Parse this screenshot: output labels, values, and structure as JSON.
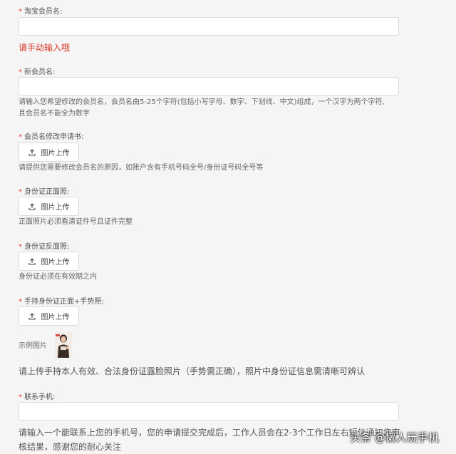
{
  "fields": {
    "taobao_name": {
      "label": "淘宝会员名:",
      "value": ""
    },
    "manual_warning": "请手动输入哦",
    "new_name": {
      "label": "新会员名:",
      "value": "",
      "hint_line1": "请输入您希望修改的会员名，会员名由5-25个字符(包括小写字母、数字、下划线、中文)组成，一个汉字为两个字符,",
      "hint_line2": "且会员名不能全为数字"
    },
    "application": {
      "label": "会员名修改申请书:",
      "upload_label": "图片上传",
      "hint": "请提供您需要修改会员名的原因，如账户含有手机号码全号/身份证号码全号等"
    },
    "id_front": {
      "label": "身份证正面照:",
      "upload_label": "图片上传",
      "hint": "正面照片必须看清证件号且证件完整"
    },
    "id_back": {
      "label": "身份证反面照:",
      "upload_label": "图片上传",
      "hint": "身份证必须在有效期之内"
    },
    "handheld": {
      "label": "手持身份证正面+手势照:",
      "upload_label": "图片上传",
      "example_label": "示例图片",
      "hint": "请上传手持本人有效、合法身份证露脸照片（手势需正确），照片中身份证信息需清晰可辨认"
    },
    "phone": {
      "label": "联系手机:",
      "value": "",
      "hint_line1": "请输入一个能联系上您的手机号，您的申请提交完成后，工作人员会在2-3个工作日左右短信通知您审",
      "hint_line2": "核结果，感谢您的耐心关注"
    }
  },
  "required_mark": "*",
  "watermark": "头条 @懒人玩手机",
  "colors": {
    "required": "#e4393c",
    "warning": "#d93a2b",
    "background": "#f5f5f5"
  },
  "icons": {
    "upload": "upload-icon"
  }
}
